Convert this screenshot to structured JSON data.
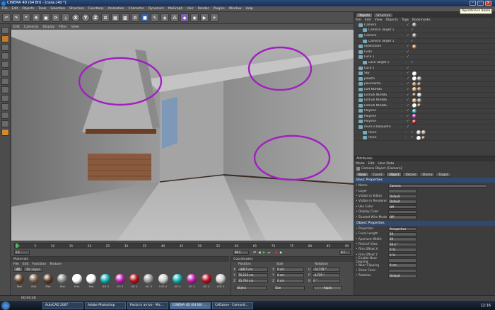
{
  "window": {
    "title": "CINEMA 4D (64 Bit) - [casa.c4d *]"
  },
  "menubar": [
    "File",
    "Edit",
    "Objects",
    "Tools",
    "Selection",
    "Structure",
    "Functions",
    "Animation",
    "Character",
    "Dynamics",
    "MoGraph",
    "Hair",
    "Render",
    "Plugins",
    "Window",
    "Help"
  ],
  "toolbar": {
    "axes": [
      "X",
      "Y",
      "Z"
    ],
    "tooltip": "Ripristina in basso"
  },
  "viewport": {
    "menu": [
      "Edit",
      "Cameras",
      "Display",
      "Filter",
      "View"
    ]
  },
  "timeline": {
    "ticks": [
      "0",
      "5",
      "10",
      "15",
      "20",
      "25",
      "30",
      "35",
      "40",
      "45",
      "50",
      "55",
      "60",
      "65",
      "70",
      "75",
      "80",
      "85",
      "90"
    ],
    "start_frame": "0 F",
    "end_frame": "90 F",
    "current_frame": "0 F"
  },
  "materials": {
    "title": "Materials",
    "menu": [
      "File",
      "Edit",
      "Function",
      "Texture"
    ],
    "filters": [
      "All",
      "No Layer"
    ],
    "items": [
      {
        "name": "Mat",
        "color": "#6b4a34"
      },
      {
        "name": "Mat",
        "color": "#7d6048"
      },
      {
        "name": "Mat",
        "color": "#5e3d26"
      },
      {
        "name": "Mat",
        "color": "#8a8a8a"
      },
      {
        "name": "Mat",
        "color": "#ffffff"
      },
      {
        "name": "Mat",
        "color": "#ffffff"
      },
      {
        "name": "AO 4",
        "color": "#12b3b8"
      },
      {
        "name": "AO 4",
        "color": "#c21fb0"
      },
      {
        "name": "AO 4",
        "color": "#b3121c"
      },
      {
        "name": "AO 4",
        "color": "#9c9c9c"
      },
      {
        "name": "LVD 4",
        "color": "#cfcfcf"
      },
      {
        "name": "AO 4",
        "color": "#12b3b8"
      },
      {
        "name": "AO 4",
        "color": "#c21fb0"
      },
      {
        "name": "AO 4",
        "color": "#b3121c"
      },
      {
        "name": "LVD 4",
        "color": "#cfcfcf"
      }
    ]
  },
  "coords": {
    "title": "Coordinates",
    "headers": [
      "Position",
      "Size",
      "Rotation"
    ],
    "rows": [
      {
        "axis": "X",
        "pos": "-168.5 cm",
        "size": "0 cm",
        "rot_label": "H",
        "rot": "-74.779 °"
      },
      {
        "axis": "Y",
        "pos": "76.215 cm",
        "size": "0 cm",
        "rot_label": "P",
        "rot": "-4.735 °"
      },
      {
        "axis": "Z",
        "pos": "35.764 cm",
        "size": "0 cm",
        "rot_label": "B",
        "rot": "0 °"
      }
    ],
    "mode_a": "Object",
    "mode_b": "Size",
    "apply": "Apply"
  },
  "objects": {
    "tabs": [
      "Objects",
      "Structure"
    ],
    "menu": [
      "File",
      "Edit",
      "View",
      "Objects",
      "Tags",
      "Bookmarks"
    ],
    "items": [
      {
        "name": "Camera",
        "indent": 0,
        "tags": [
          "#8a8a8a"
        ]
      },
      {
        "name": "Camera Target 1",
        "indent": 1,
        "tags": []
      },
      {
        "name": "Camera",
        "indent": 0,
        "tags": [
          "#8a8a8a"
        ]
      },
      {
        "name": "Camera Target 1",
        "indent": 1,
        "tags": []
      },
      {
        "name": "esterizzare",
        "indent": 0,
        "tags": [
          "#c56a2d"
        ]
      },
      {
        "name": "Cielo",
        "indent": 0,
        "tags": []
      },
      {
        "name": "Luce 1",
        "indent": 0,
        "tags": []
      },
      {
        "name": "Luce Target 1",
        "indent": 1,
        "tags": []
      },
      {
        "name": "Luce 2",
        "indent": 0,
        "tags": []
      },
      {
        "name": "Sky",
        "indent": 0,
        "tags": [
          "#ffffff"
        ]
      },
      {
        "name": "pilastri",
        "indent": 0,
        "tags": [
          "#ffffff",
          "#9c9c9c"
        ]
      },
      {
        "name": "pavimento",
        "indent": 0,
        "tags": [
          "#a07048",
          "#6b4a34"
        ]
      },
      {
        "name": "Loft NURBS",
        "indent": 0,
        "tags": [
          "#d09a6a",
          "#7d6048"
        ]
      },
      {
        "name": "Estrudi NURBS",
        "indent": 0,
        "tags": [
          "#5e3d26",
          "#cfcfcf"
        ]
      },
      {
        "name": "Estrudi NURBS",
        "indent": 0,
        "tags": [
          "#d0a070",
          "#8a8a8a"
        ]
      },
      {
        "name": "Estrudi NURBS",
        "indent": 0,
        "tags": [
          "#ffffff",
          "#5e3d26"
        ]
      },
      {
        "name": "Polyline",
        "indent": 0,
        "tags": [
          "#12b3b8"
        ]
      },
      {
        "name": "Polyline",
        "indent": 0,
        "tags": [
          "#c21fb0"
        ]
      },
      {
        "name": "Polyline",
        "indent": 0,
        "tags": [
          "#b3121c"
        ]
      },
      {
        "name": "muro e balaustre",
        "indent": 0,
        "tags": []
      },
      {
        "name": "muro",
        "indent": 1,
        "tags": [
          "#cfcfcf",
          "#9c9c9c"
        ]
      },
      {
        "name": "muro",
        "indent": 1,
        "tags": [
          "#ffffff",
          "#5e3d26"
        ]
      }
    ]
  },
  "attributes": {
    "title": "Attributes",
    "menu": [
      "Mode",
      "Edit",
      "User Data"
    ],
    "object": "Camera Object [Camera]",
    "tabs": [
      "Basic",
      "Coord.",
      "Object",
      "Details",
      "Stereo",
      "Target"
    ],
    "basic_title": "Basic Properties",
    "basic": [
      {
        "label": "Name",
        "value": "Camera"
      },
      {
        "label": "Layer",
        "value": ""
      },
      {
        "label": "Visible in Editor",
        "value": "Default"
      },
      {
        "label": "Visible in Renderer",
        "value": "Default"
      },
      {
        "label": "Use Color",
        "value": "Off"
      },
      {
        "label": "Display Color",
        "value": ""
      },
      {
        "label": "Shaded Wire Mode",
        "value": "Off"
      }
    ],
    "object_title": "Object Properties",
    "object_props": [
      {
        "label": "Projection",
        "value": "Perspective"
      },
      {
        "label": "Focal Length",
        "value": "26"
      },
      {
        "label": "Aperture Width",
        "value": "36"
      },
      {
        "label": "Field of View",
        "value": "69.4 °"
      },
      {
        "label": "Film Offset X",
        "value": "0 %"
      },
      {
        "label": "Film Offset Y",
        "value": "0 %"
      },
      {
        "label": "Enable Near Clipping",
        "value": ""
      },
      {
        "label": "Near Clipping",
        "value": "0 cm"
      },
      {
        "label": "Show Cone",
        "value": ""
      },
      {
        "label": "Rotation",
        "value": "Default"
      }
    ]
  },
  "status": {
    "time": "00:00:36"
  },
  "taskbar": {
    "items": [
      "AutoCAD 2007",
      "Adobe Photoshop",
      "Posta in arrivo - Mic...",
      "CINEMA 4D (64 Bit) ...",
      "CADzone - Comunit..."
    ],
    "active": 3,
    "clock": "12:16"
  },
  "colors": {
    "annotation": "#a21fbf",
    "accent": "#2f4a6e"
  }
}
